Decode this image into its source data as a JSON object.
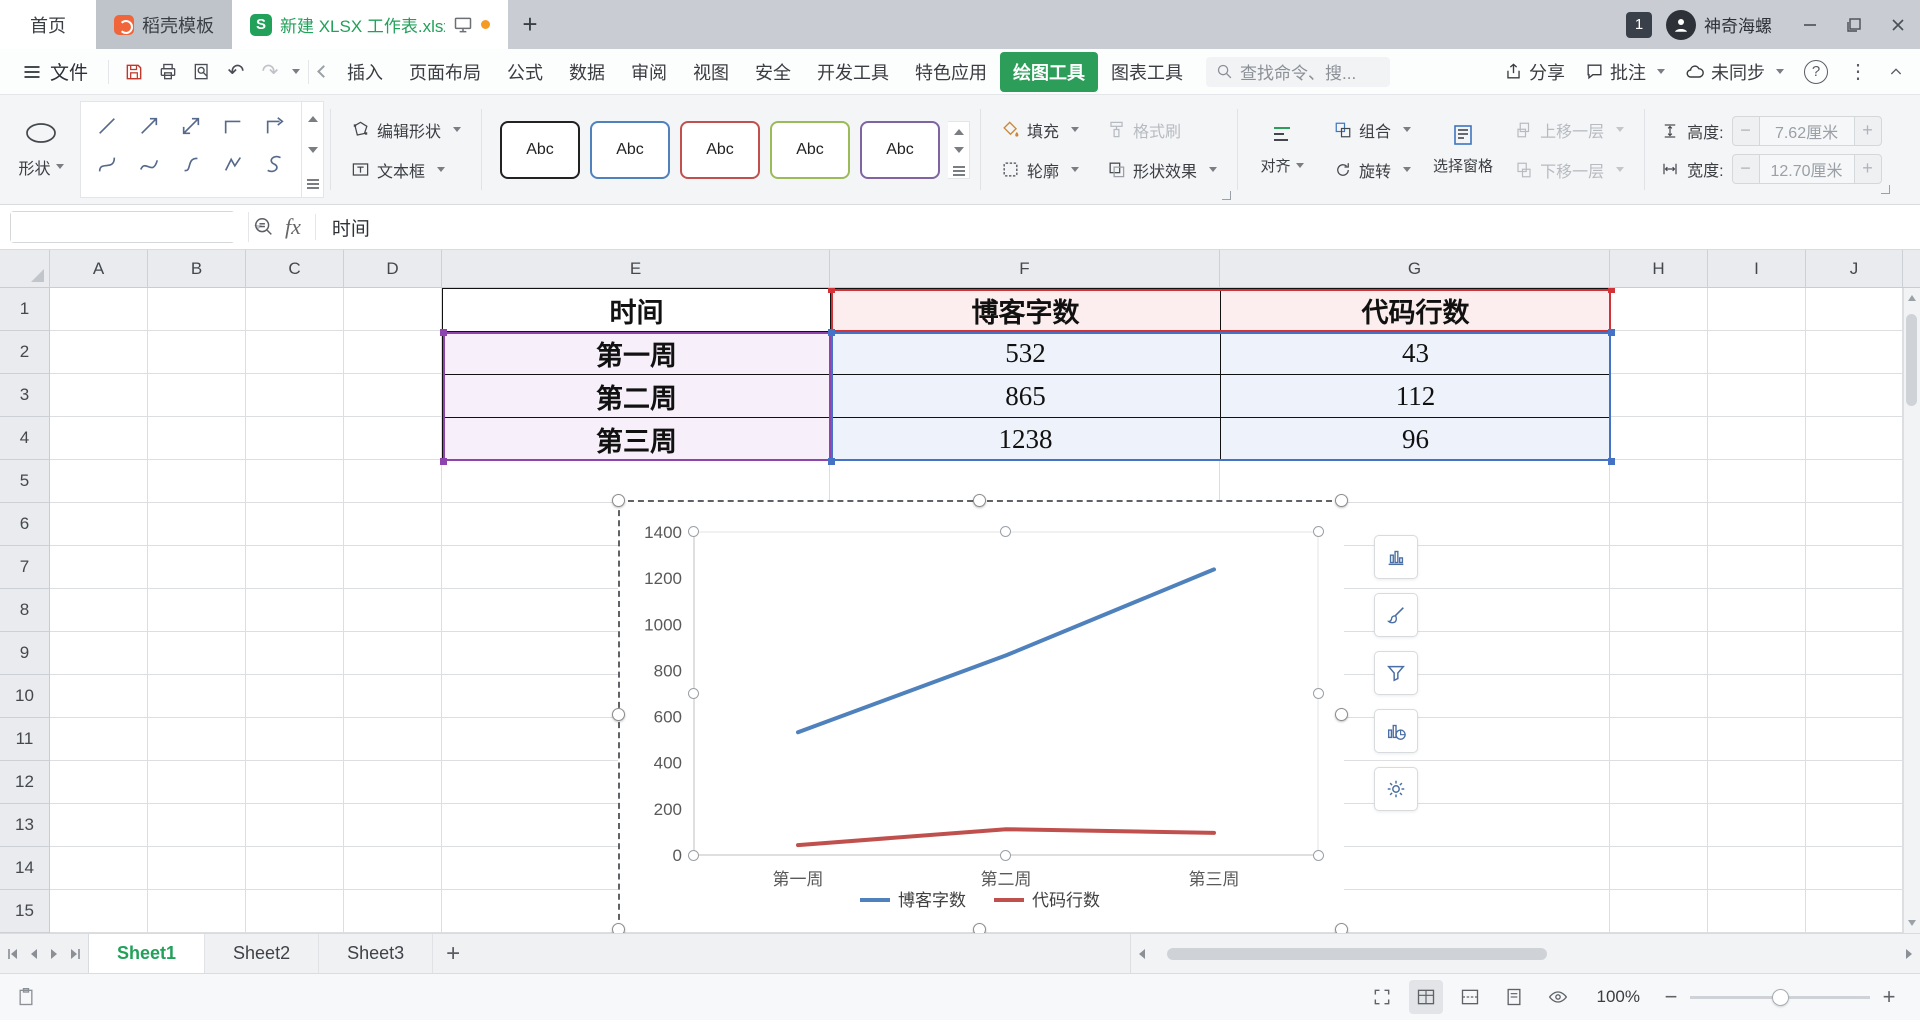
{
  "tabbar": {
    "home_tab": "首页",
    "docer_tab": "稻壳模板",
    "doc_tab": "新建 XLSX 工作表.xlsx",
    "badge": "1",
    "user": "神奇海螺"
  },
  "menubar": {
    "file": "文件",
    "tabs": [
      "插入",
      "页面布局",
      "公式",
      "数据",
      "审阅",
      "视图",
      "安全",
      "开发工具",
      "特色应用",
      "绘图工具",
      "图表工具"
    ],
    "active_tab": "绘图工具",
    "search_placeholder": "查找命令、搜...",
    "share": "分享",
    "comment": "批注",
    "sync": "未同步"
  },
  "ribbon": {
    "shape": "形状",
    "edit_shape": "编辑形状",
    "text_box": "文本框",
    "presets": [
      {
        "label": "Abc",
        "border": "#222222"
      },
      {
        "label": "Abc",
        "border": "#4f81bd"
      },
      {
        "label": "Abc",
        "border": "#c0504d"
      },
      {
        "label": "Abc",
        "border": "#9bbb59"
      },
      {
        "label": "Abc",
        "border": "#8064a2"
      }
    ],
    "fill": "填充",
    "format_painter": "格式刷",
    "outline": "轮廓",
    "shape_effects": "形状效果",
    "align": "对齐",
    "group": "组合",
    "rotate": "旋转",
    "selection_pane": "选择窗格",
    "bring_forward": "上移一层",
    "send_backward": "下移一层",
    "height_label": "高度:",
    "height_value": "7.62厘米",
    "width_label": "宽度:",
    "width_value": "12.70厘米"
  },
  "formula_bar": {
    "name_box": "",
    "fx_label": "fx",
    "content": "时间"
  },
  "grid": {
    "columns": [
      "A",
      "B",
      "C",
      "D",
      "E",
      "F",
      "G",
      "H",
      "I",
      "J"
    ],
    "rows": [
      "1",
      "2",
      "3",
      "4",
      "5",
      "6",
      "7",
      "8",
      "9",
      "10",
      "11",
      "12",
      "13",
      "14",
      "15"
    ],
    "table": {
      "headers": [
        "时间",
        "博客字数",
        "代码行数"
      ],
      "rows": [
        [
          "第一周",
          "532",
          "43"
        ],
        [
          "第二周",
          "865",
          "112"
        ],
        [
          "第三周",
          "1238",
          "96"
        ]
      ]
    }
  },
  "chart_data": {
    "type": "line",
    "title": "",
    "categories": [
      "第一周",
      "第二周",
      "第三周"
    ],
    "series": [
      {
        "name": "博客字数",
        "values": [
          532,
          865,
          1238
        ],
        "color": "#4f81bd"
      },
      {
        "name": "代码行数",
        "values": [
          43,
          112,
          96
        ],
        "color": "#c0504d"
      }
    ],
    "ylim": [
      0,
      1400
    ],
    "ytick_step": 200,
    "grid": false,
    "legend_position": "bottom"
  },
  "sheetbar": {
    "sheets": [
      "Sheet1",
      "Sheet2",
      "Sheet3"
    ],
    "active": "Sheet1"
  },
  "statusbar": {
    "zoom": "100%"
  },
  "glyphs": {
    "dropdown": "▾",
    "minus": "−",
    "plus": "+",
    "undo": "↶",
    "redo": "↷",
    "more": "⋮",
    "help": "?",
    "wps_s": "S",
    "abc": "Abc"
  }
}
